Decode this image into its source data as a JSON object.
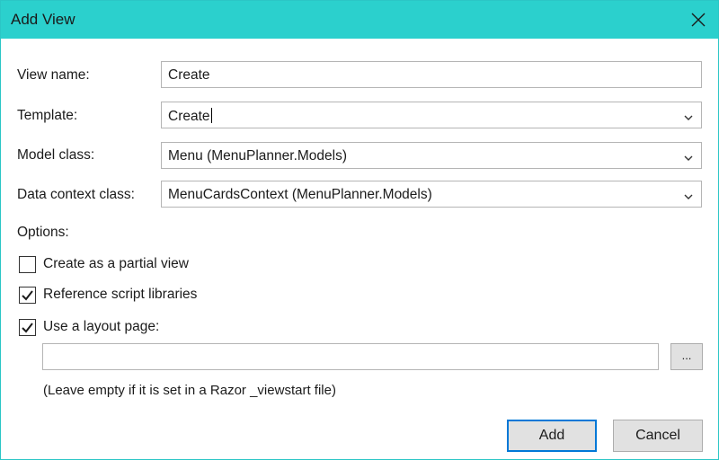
{
  "window": {
    "title": "Add View"
  },
  "form": {
    "view_name": {
      "label": "View name:",
      "value": "Create"
    },
    "template": {
      "label": "Template:",
      "value": "Create"
    },
    "model_class": {
      "label": "Model class:",
      "value": "Menu (MenuPlanner.Models)"
    },
    "data_context_class": {
      "label": "Data context class:",
      "value": "MenuCardsContext (MenuPlanner.Models)"
    }
  },
  "options": {
    "heading": "Options:",
    "partial_view": {
      "label": "Create as a partial view",
      "checked": false
    },
    "reference_scripts": {
      "label": "Reference script libraries",
      "checked": true
    },
    "use_layout": {
      "label": "Use a layout page:",
      "checked": true
    },
    "layout_path": {
      "value": "",
      "browse_label": "..."
    },
    "hint": "(Leave empty if it is set in a Razor _viewstart file)"
  },
  "buttons": {
    "add": "Add",
    "cancel": "Cancel"
  },
  "colors": {
    "titlebar": "#2bd0cd",
    "accent": "#0078d7"
  },
  "icons": {
    "close": "close-icon",
    "dropdown": "chevron-down-icon",
    "check": "checkmark-icon"
  }
}
